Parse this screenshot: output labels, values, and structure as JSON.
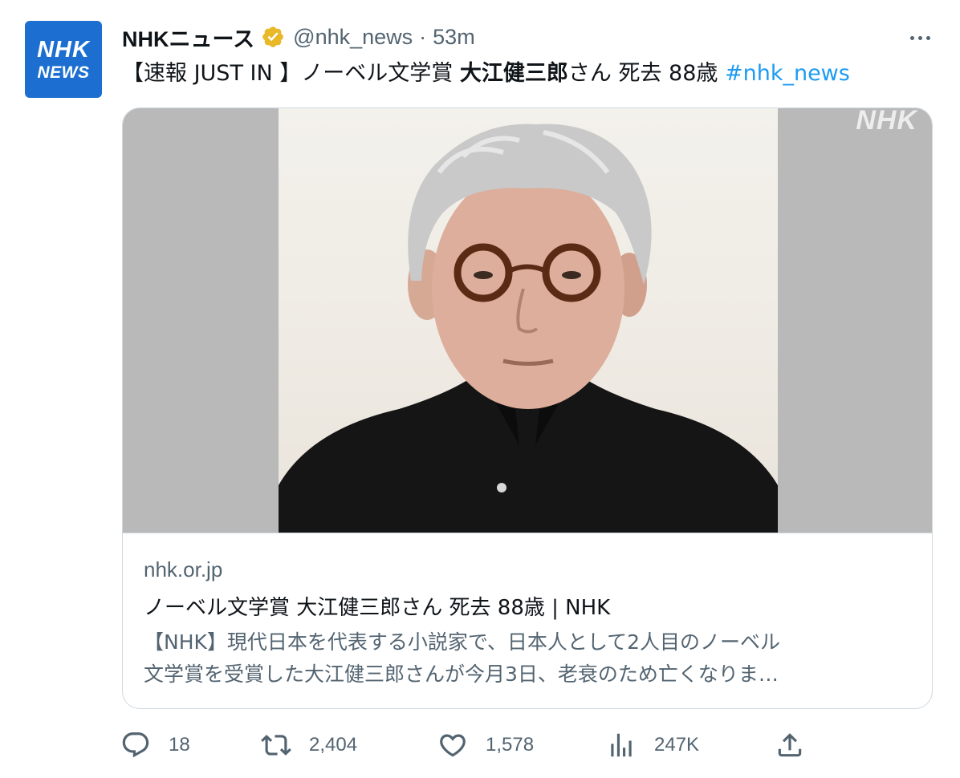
{
  "tweet": {
    "avatar": {
      "line1": "NHK",
      "line2": "NEWS",
      "color": "#1c6fd0"
    },
    "display_name": "NHKニュース",
    "verified_icon": "gold-verified-badge-icon",
    "handle": "@nhk_news",
    "separator": "·",
    "time": "53m",
    "more_icon": "more-dots-icon",
    "text": {
      "prefix": "【速報 JUST IN 】ノーベル文学賞 ",
      "bold": "大江健三郎",
      "suffix": "さん 死去 88歳 ",
      "hashtag": "#nhk_news"
    },
    "card": {
      "image_watermark": "NHK",
      "domain": "nhk.or.jp",
      "title": "ノーベル文学賞 大江健三郎さん 死去 88歳 | NHK",
      "description_line1": "【NHK】現代日本を代表する小説家で、日本人として2人目のノーベル",
      "description_line2": "文学賞を受賞した大江健三郎さんが今月3日、老衰のため亡くなりま…"
    },
    "actions": {
      "reply": {
        "icon": "reply-icon",
        "count": "18"
      },
      "retweet": {
        "icon": "retweet-icon",
        "count": "2,404"
      },
      "like": {
        "icon": "heart-icon",
        "count": "1,578"
      },
      "views": {
        "icon": "analytics-icon",
        "count": "247K"
      },
      "share": {
        "icon": "share-icon"
      }
    }
  },
  "colors": {
    "text_primary": "#0f1419",
    "text_secondary": "#536471",
    "link": "#1d9bf0",
    "border": "#cfd9de",
    "verified_gold": "#e8b829"
  }
}
